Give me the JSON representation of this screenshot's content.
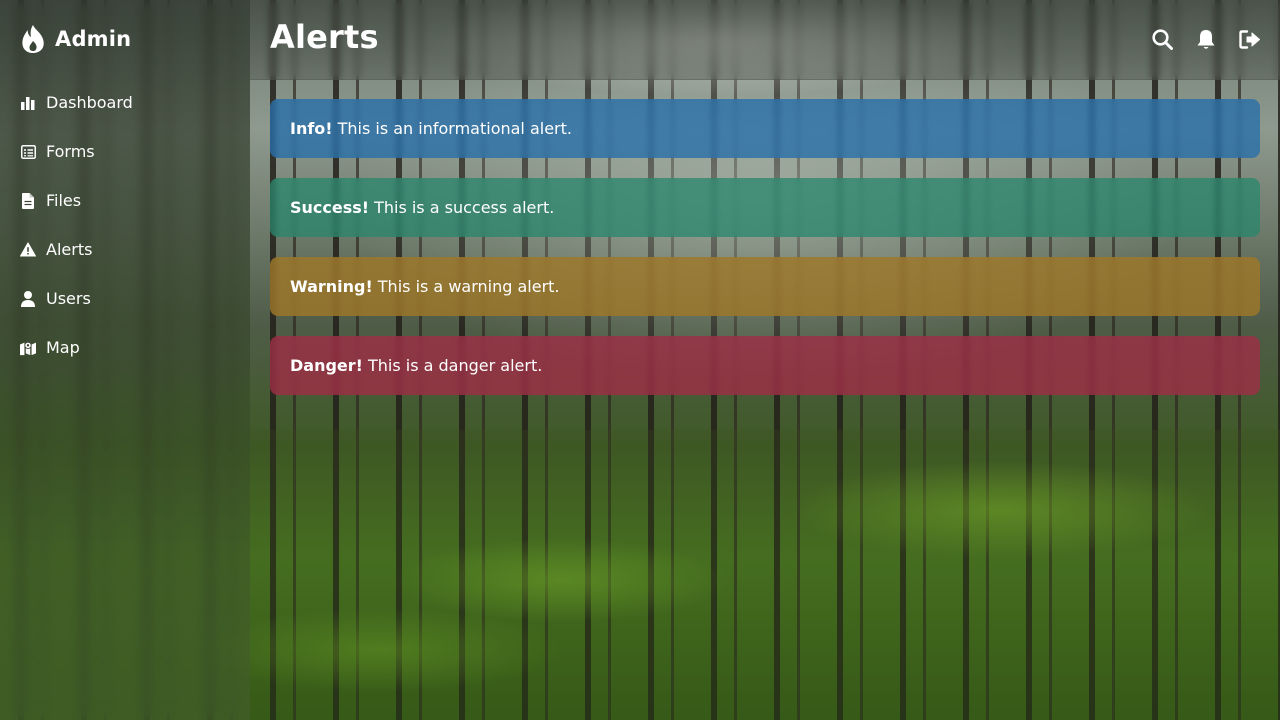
{
  "app": {
    "brand": "Admin",
    "brand_icon": "flame-icon"
  },
  "header": {
    "title": "Alerts",
    "actions": [
      {
        "icon": "search-icon"
      },
      {
        "icon": "bell-icon"
      },
      {
        "icon": "logout-icon"
      }
    ]
  },
  "sidebar": {
    "items": [
      {
        "label": "Dashboard",
        "icon": "bar-chart-icon"
      },
      {
        "label": "Forms",
        "icon": "form-icon"
      },
      {
        "label": "Files",
        "icon": "file-icon"
      },
      {
        "label": "Alerts",
        "icon": "warning-icon"
      },
      {
        "label": "Users",
        "icon": "user-icon"
      },
      {
        "label": "Map",
        "icon": "map-icon"
      }
    ]
  },
  "alerts": [
    {
      "type": "info",
      "title": "Info!",
      "message": "This is an informational alert.",
      "color": "#266eaa"
    },
    {
      "type": "success",
      "title": "Success!",
      "message": "This is a success alert.",
      "color": "#28876e"
    },
    {
      "type": "warning",
      "title": "Warning!",
      "message": "This is a warning alert.",
      "color": "#a07828"
    },
    {
      "type": "danger",
      "title": "Danger!",
      "message": "This is a danger alert.",
      "color": "#a02d46"
    }
  ]
}
